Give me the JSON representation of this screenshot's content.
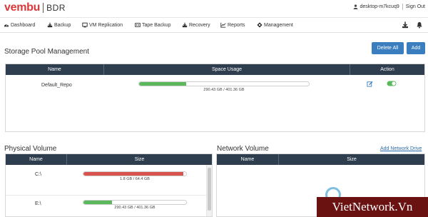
{
  "header": {
    "logo": "vembu",
    "product": "BDR",
    "user": "desktop-m7kcuq9",
    "sign_out": "Sign Out"
  },
  "nav": {
    "items": [
      {
        "label": "Dashboard",
        "icon": "dashboard-icon"
      },
      {
        "label": "Backup",
        "icon": "backup-icon"
      },
      {
        "label": "VM Replication",
        "icon": "vm-replication-icon"
      },
      {
        "label": "Tape Backup",
        "icon": "tape-icon"
      },
      {
        "label": "Recovery",
        "icon": "recovery-icon"
      },
      {
        "label": "Reports",
        "icon": "reports-icon"
      },
      {
        "label": "Management",
        "icon": "management-icon"
      }
    ],
    "right_icons": [
      "download-icon",
      "bell-icon"
    ]
  },
  "storage_pool": {
    "title": "Storage Pool Management",
    "delete_all": "Delete All",
    "add": "Add",
    "columns": [
      "Name",
      "Space Usage",
      "Action"
    ],
    "rows": [
      {
        "name": "Default_Repo",
        "usage_label": "290.43 GB / 401.36 GB",
        "usage_fraction": 0.276,
        "bar_color": "#5cb85c"
      }
    ]
  },
  "physical_volume": {
    "title": "Physical Volume",
    "columns": [
      "Name",
      "Size"
    ],
    "rows": [
      {
        "name": "C:\\",
        "usage_label": "1.8 GB / 64.4 GB",
        "usage_fraction": 0.97,
        "bar_color": "#d9534f"
      },
      {
        "name": "E:\\",
        "usage_label": "290.43 GB / 401.36 GB",
        "usage_fraction": 0.276,
        "bar_color": "#5cb85c"
      }
    ]
  },
  "network_volume": {
    "title": "Network Volume",
    "add_link": "Add Network Drive",
    "columns": [
      "Name",
      "Size"
    ]
  },
  "watermark": "VietNetwork.Vn"
}
